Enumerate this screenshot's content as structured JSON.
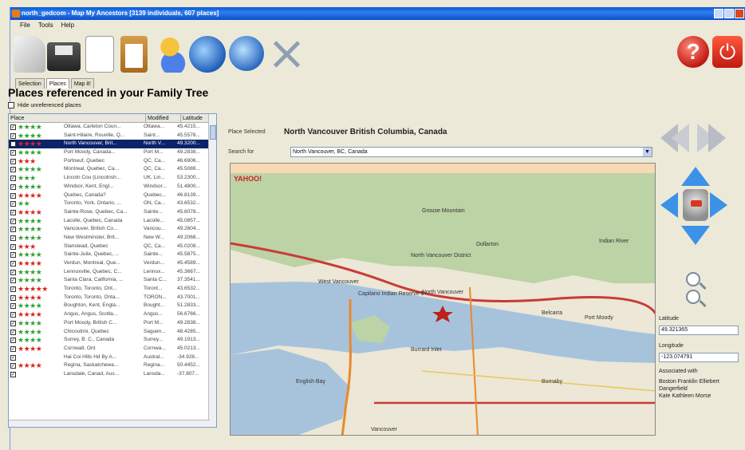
{
  "window": {
    "title": "north_gedcom - Map My Ancestors [3139 individuals, 607 places]"
  },
  "menu": [
    "File",
    "Tools",
    "Help"
  ],
  "tabs": [
    "Selection",
    "Places",
    "Map it!"
  ],
  "heading": "Places referenced in your Family Tree",
  "hide_label": "Hide unreferenced places",
  "places_table": {
    "columns": [
      "Place",
      "Modified",
      "Latitude"
    ],
    "rows": [
      {
        "stars": "★★★★",
        "name": "Ottawa, Carleton Coun...",
        "mod": "Ottawa...",
        "lat": "45.4215...",
        "sel": false
      },
      {
        "stars": "★★★★",
        "name": "Saint-Hilaire, Rouville, Q...",
        "mod": "Saint...",
        "lat": "45.5578...",
        "sel": false
      },
      {
        "stars": "★★★★",
        "name": "North Vancouver, Brit...",
        "mod": "North V...",
        "lat": "49.3200...",
        "sel": true
      },
      {
        "stars": "★★★★",
        "name": "Port Moody, Canada...",
        "mod": "Port M...",
        "lat": "49.2838...",
        "sel": false
      },
      {
        "stars": "★★★",
        "name": "Portneuf, Quebec",
        "mod": "QC, Ca...",
        "lat": "46.6906...",
        "sel": false
      },
      {
        "stars": "★★★★",
        "name": "Montreal, Quebec, Ca...",
        "mod": "QC, Ca...",
        "lat": "45.5088...",
        "sel": false
      },
      {
        "stars": "★★★",
        "name": "Lincoln Cou (Lincolnsh...",
        "mod": "UK, Lin...",
        "lat": "53.2300...",
        "sel": false
      },
      {
        "stars": "★★★★",
        "name": "Windsor, Kent, Engl...",
        "mod": "Windsor...",
        "lat": "51.4800...",
        "sel": false
      },
      {
        "stars": "★★★★",
        "name": "Quebec, Canada?",
        "mod": "Quebec...",
        "lat": "46.8139...",
        "sel": false
      },
      {
        "stars": "★★",
        "name": "Toronto, York, Ontario, ...",
        "mod": "ON, Ca...",
        "lat": "43.6532...",
        "sel": false
      },
      {
        "stars": "★★★★",
        "name": "Sainte-Rose, Quebec, Ca...",
        "mod": "Sainte...",
        "lat": "45.6078...",
        "sel": false
      },
      {
        "stars": "★★★★",
        "name": "Lacolle, Quebec, Canada",
        "mod": "Lacolle...",
        "lat": "45.0857...",
        "sel": false
      },
      {
        "stars": "★★★★",
        "name": "Vancouver, British Co...",
        "mod": "Vancou...",
        "lat": "49.2604...",
        "sel": false
      },
      {
        "stars": "★★★★",
        "name": "New Westminster, Brit...",
        "mod": "New W...",
        "lat": "49.2068...",
        "sel": false
      },
      {
        "stars": "★★★",
        "name": "Stanstead, Quebec",
        "mod": "QC, Ca...",
        "lat": "45.0208...",
        "sel": false
      },
      {
        "stars": "★★★★",
        "name": "Sainte-Julie, Quebec, ...",
        "mod": "Sainte...",
        "lat": "45.5875...",
        "sel": false
      },
      {
        "stars": "★★★★",
        "name": "Verdun, Montreal, Que...",
        "mod": "Verdun...",
        "lat": "45.4589...",
        "sel": false
      },
      {
        "stars": "★★★★",
        "name": "Lennoxville, Quebec, C...",
        "mod": "Lennox...",
        "lat": "45.3667...",
        "sel": false
      },
      {
        "stars": "★★★★",
        "name": "Santa Clara, California, ...",
        "mod": "Santa C...",
        "lat": "37.3541...",
        "sel": false
      },
      {
        "stars": "★★★★★",
        "name": "Toronto, Toronto, Ont...",
        "mod": "Toront...",
        "lat": "43.6532...",
        "sel": false
      },
      {
        "stars": "★★★★",
        "name": "Toronto, Toronto, Onta...",
        "mod": "TORON...",
        "lat": "43.7001...",
        "sel": false
      },
      {
        "stars": "★★★★",
        "name": "Boughton, Kent, Engla...",
        "mod": "Bought...",
        "lat": "51.2833...",
        "sel": false
      },
      {
        "stars": "★★★★",
        "name": "Angus, Angus, Scotla...",
        "mod": "Angus...",
        "lat": "56.6766...",
        "sel": false
      },
      {
        "stars": "★★★★",
        "name": "Port Moody, British C...",
        "mod": "Port M...",
        "lat": "49.2838...",
        "sel": false
      },
      {
        "stars": "★★★★",
        "name": "Chicoutimi, Quebec",
        "mod": "Saguen...",
        "lat": "48.4285...",
        "sel": false
      },
      {
        "stars": "★★★★",
        "name": "Surrey, B. C., Canada",
        "mod": "Surrey...",
        "lat": "49.1913...",
        "sel": false
      },
      {
        "stars": "★★★★",
        "name": "Cornwall, Ont",
        "mod": "Cornwa...",
        "lat": "45.0213...",
        "sel": false
      },
      {
        "stars": "",
        "name": "Hai Coi Hills Hd By A...",
        "mod": "Austral...",
        "lat": "-34.928...",
        "sel": false
      },
      {
        "stars": "★★★★",
        "name": "Regina, Saskatchewa...",
        "mod": "Regina...",
        "lat": "50.4452...",
        "sel": false
      },
      {
        "stars": "",
        "name": "Lansdale, Canad, Aus...",
        "mod": "Lansda...",
        "lat": "-37.807...",
        "sel": false
      }
    ]
  },
  "place_selected_label": "Place Selected",
  "place_selected_value": "North Vancouver British Columbia, Canada",
  "search_label": "Search for",
  "search_value": "North Vancouver, BC, Canada",
  "map": {
    "logo": "YAHOO!",
    "labels": [
      "North Vancouver District",
      "West Vancouver",
      "Capilano Indian Reserve 5",
      "North Vancouver",
      "Burrard Inlet",
      "English Bay",
      "Vancouver",
      "Burnaby",
      "Port Moody",
      "Dollarton",
      "Belcarra",
      "Grouse Mountain",
      "Indian River"
    ]
  },
  "side": {
    "latitude_label": "Latitude",
    "latitude_value": "49.321365",
    "longitude_label": "Longitude",
    "longitude_value": "-123.074791",
    "associated_label": "Associated with",
    "associated_names": [
      "Boston Franklin Elliebert",
      "Dangerfield",
      "Kate Kathleen Morse"
    ]
  },
  "colors": {
    "selection": "#0a246a",
    "star_red": "#d8261a",
    "star_green": "#2fa22f",
    "accent_blue": "#3c92e6"
  }
}
